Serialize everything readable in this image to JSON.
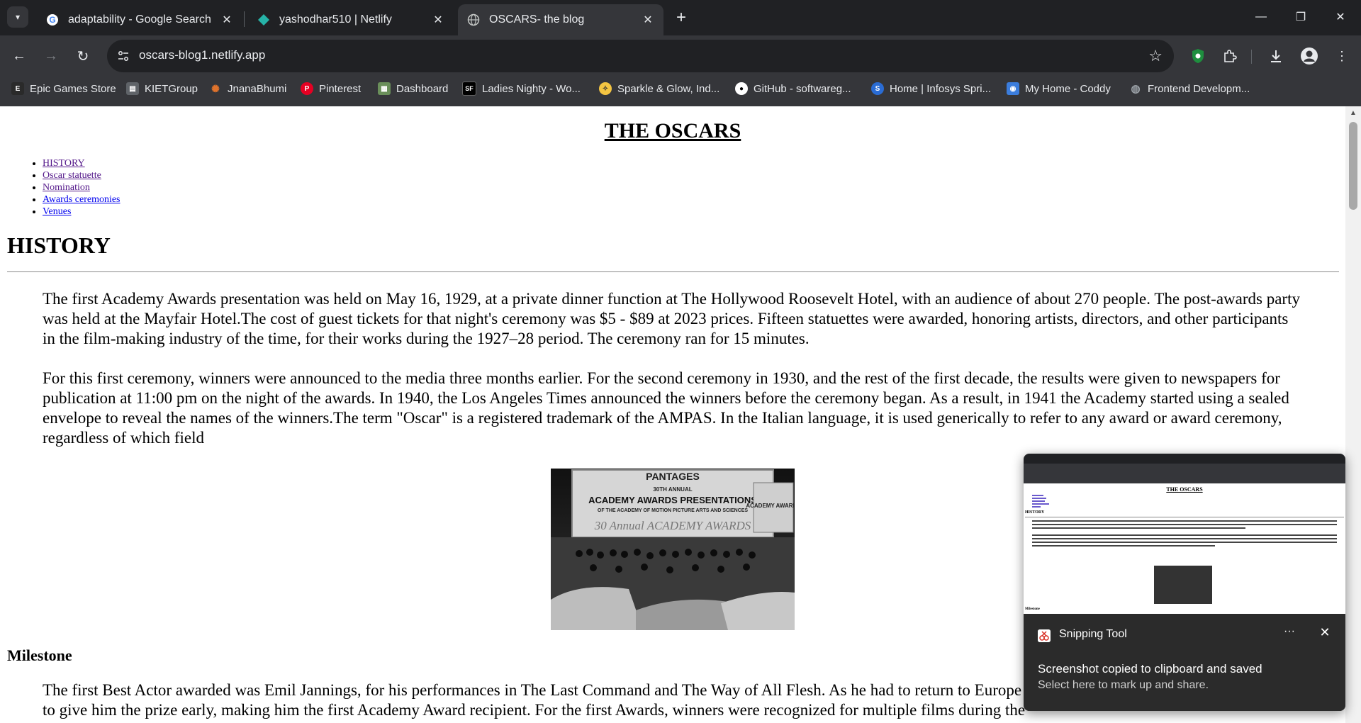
{
  "browser": {
    "tabs": [
      {
        "title": "adaptability - Google Search",
        "icon": "google-icon",
        "active": false
      },
      {
        "title": "yashodhar510 | Netlify",
        "icon": "netlify-icon",
        "active": false
      },
      {
        "title": "OSCARS- the blog",
        "icon": "globe-icon",
        "active": true
      }
    ],
    "url": "oscars-blog1.netlify.app",
    "bookmarks": [
      {
        "label": "Epic Games Store",
        "icon": "epic-games-icon",
        "color": "#2a2a2a"
      },
      {
        "label": "KIETGroup",
        "icon": "page-icon",
        "color": "#5f6368"
      },
      {
        "label": "JnanaBhumi",
        "icon": "jnanabhumi-icon",
        "color": "#e0732c"
      },
      {
        "label": "Pinterest",
        "icon": "pinterest-icon",
        "color": "#e60023"
      },
      {
        "label": "Dashboard",
        "icon": "dashboard-icon",
        "color": "#6a8f5a"
      },
      {
        "label": "Ladies Nighty - Wo...",
        "icon": "sf-icon",
        "color": "#000000"
      },
      {
        "label": "Sparkle & Glow, Ind...",
        "icon": "sparkle-icon",
        "color": "#f4c542"
      },
      {
        "label": "GitHub - softwareg...",
        "icon": "github-icon",
        "color": "#ffffff"
      },
      {
        "label": "Home | Infosys Spri...",
        "icon": "infosys-icon",
        "color": "#2a6cd4"
      },
      {
        "label": "My Home - Coddy",
        "icon": "coddy-icon",
        "color": "#3b7ddd"
      },
      {
        "label": "Frontend Developm...",
        "icon": "globe-icon",
        "color": "#9aa0a6"
      }
    ]
  },
  "page": {
    "title": "THE OSCARS",
    "nav": [
      "HISTORY",
      "Oscar statuette",
      "Nomination",
      "Awards ceremonies",
      "Venues"
    ],
    "history_heading": "HISTORY",
    "history_p1": "The first Academy Awards presentation was held on May 16, 1929, at a private dinner function at The Hollywood Roosevelt Hotel, with an audience of about 270 people. The post-awards party was held at the Mayfair Hotel.The cost of guest tickets for that night's ceremony was $5 - $89 at 2023 prices. Fifteen statuettes were awarded, honoring artists, directors, and other participants in the film-making industry of the time, for their works during the 1927–28 period. The ceremony ran for 15 minutes.",
    "history_p2": "For this first ceremony, winners were announced to the media three months earlier. For the second ceremony in 1930, and the rest of the first decade, the results were given to newspapers for publication at 11:00 pm on the night of the awards. In 1940, the Los Angeles Times announced the winners before the ceremony began. As a result, in 1941 the Academy started using a sealed envelope to reveal the names of the winners.The term \"Oscar\" is a registered trademark of the AMPAS. In the Italian language, it is used generically to refer to any award or award ceremony, regardless of which field",
    "image": {
      "marquee_top": "PANTAGES",
      "marquee_line1": "30TH ANNUAL",
      "marquee_line2": "ACADEMY AWARDS PRESENTATIONS",
      "marquee_line3": "OF THE ACADEMY OF MOTION PICTURE ARTS AND SCIENCES",
      "marquee_line4": "30 Annual ACADEMY AWARDS",
      "side_sign": "ACADEMY AWARDS"
    },
    "milestone_heading": "Milestone",
    "milestone_p1": "The first Best Actor awarded was Emil Jannings, for his performances in The Last Command and The Way of All Flesh. As he had to return to Europe before the ceremony, the Academy agreed to give him the prize early, making him the first Academy Award recipient. For the first Awards, winners were recognized for multiple films during the"
  },
  "snip": {
    "app_name": "Snipping Tool",
    "more_label": "···",
    "message": "Screenshot copied to clipboard and saved",
    "submessage": "Select here to mark up and share.",
    "thumb_title": "THE OSCARS",
    "thumb_heading": "HISTORY",
    "thumb_milestone": "Milestone"
  }
}
